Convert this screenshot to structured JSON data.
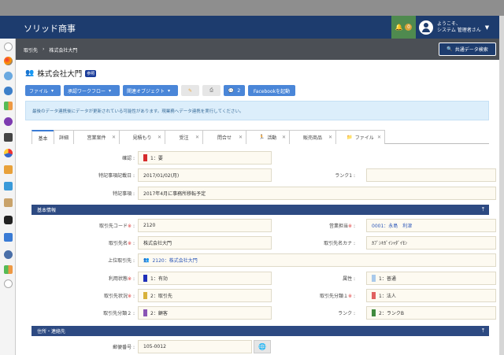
{
  "app": {
    "title": "ソリッド商事"
  },
  "header": {
    "notif_count": "0",
    "user_line1": "ようこそ、",
    "user_line2": "システム 管理者さん"
  },
  "breadcrumb": {
    "items": [
      "取引先",
      "株式会社大門"
    ],
    "separator": "›"
  },
  "share_button": {
    "label": "共通データ検索"
  },
  "page": {
    "title": "株式会社大門",
    "badge": "参照"
  },
  "toolbar": {
    "file": "ファイル",
    "workflow": "承認ワークフロー",
    "related": "関連オブジェクト",
    "comments_count": "2",
    "facebook": "Facebookを起動"
  },
  "alert": {
    "text": "最後のデータ連携後にデータが更新されている可能性があります。現業務へデータ連携を実行してください。"
  },
  "tabs": [
    "基本",
    "詳細",
    "営業案件",
    "見積もり",
    "受注",
    "問合せ",
    "活動",
    "販売商品",
    "ファイル"
  ],
  "form": {
    "confirm": {
      "label": "確認 :",
      "value": "1：要",
      "color": "#d62b2b"
    },
    "special_date": {
      "label": "特記事項記載日 :",
      "value": "2017/01/02(月)"
    },
    "rank1": {
      "label": "ランク1 :",
      "value": ""
    },
    "special_note": {
      "label": "特記事項 :",
      "value": "2017年4月に事務所移転予定"
    },
    "section_basic": "基本情報",
    "client_code": {
      "label": "取引先コード",
      "value": "2120"
    },
    "sales_rep": {
      "label": "営業担当",
      "value": "0001：永島　利津"
    },
    "client_name": {
      "label": "取引先名",
      "value": "株式会社大門"
    },
    "client_kana": {
      "label": "取引先名カナ :",
      "value": "ｶﾌﾞｼｷｶﾞｲｼｬﾀﾞｲﾓﾝ"
    },
    "parent_client": {
      "label": "上位取引先 :",
      "value": "2120：株式会社大門"
    },
    "usage": {
      "label": "利用状態",
      "value": "1：有効",
      "color": "#1f2fb8"
    },
    "attribute": {
      "label": "属性 :",
      "value": "1：普通",
      "color": "#a9c9ea"
    },
    "client_status": {
      "label": "取引先状況",
      "value": "2：取引先",
      "color": "#d8b13a"
    },
    "client_cat1": {
      "label": "取引先分類１",
      "value": "1：法人",
      "color": "#e06060"
    },
    "client_cat2": {
      "label": "取引先分類２ :",
      "value": "2：顧客",
      "color": "#8a55b5"
    },
    "rank": {
      "label": "ランク :",
      "value": "2：ランクB",
      "color": "#3f8a3f"
    },
    "section_address": "住所・連絡先",
    "postal": {
      "label": "郵便番号 :",
      "value": "105-0012"
    }
  },
  "required_mark": "※"
}
